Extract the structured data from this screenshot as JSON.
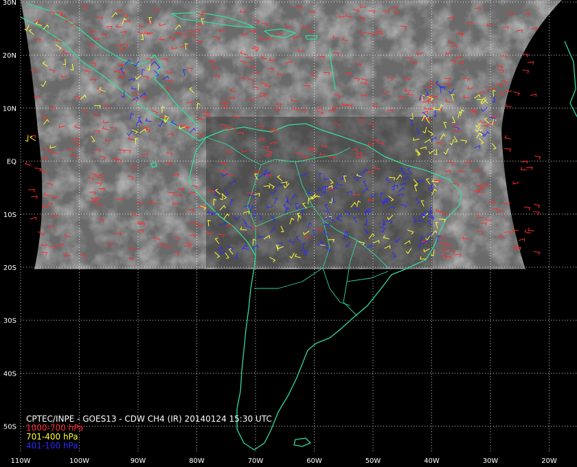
{
  "caption": "CPTEC/INPE - GOES13 - CDW CH4 (IR) 20140124 15:30 UTC",
  "legend": [
    {
      "label": "1000-700 hPa",
      "color": "#ff2a2a"
    },
    {
      "label": "701-400 hPa",
      "color": "#ffff33"
    },
    {
      "label": "401-100 hPa",
      "color": "#2a2aff"
    }
  ],
  "colors": {
    "background": "#000000",
    "coastline": "#33dd99",
    "grid": "#ffffff",
    "satellite_cloud": "#6a6a6a"
  },
  "map": {
    "lon_range": [
      -110,
      -20
    ],
    "lat_range": [
      -55,
      30
    ],
    "lon_labels": [
      "110W",
      "100W",
      "90W",
      "80W",
      "70W",
      "60W",
      "50W",
      "40W",
      "30W",
      "20W"
    ],
    "lat_labels": [
      "30N",
      "20N",
      "10N",
      "EQ",
      "10S",
      "20S",
      "30S",
      "40S",
      "50S"
    ],
    "lon_values": [
      -110,
      -100,
      -90,
      -80,
      -70,
      -60,
      -50,
      -40,
      -30,
      -20
    ],
    "lat_values": [
      30,
      20,
      10,
      0,
      -10,
      -20,
      -30,
      -40,
      -50
    ]
  }
}
